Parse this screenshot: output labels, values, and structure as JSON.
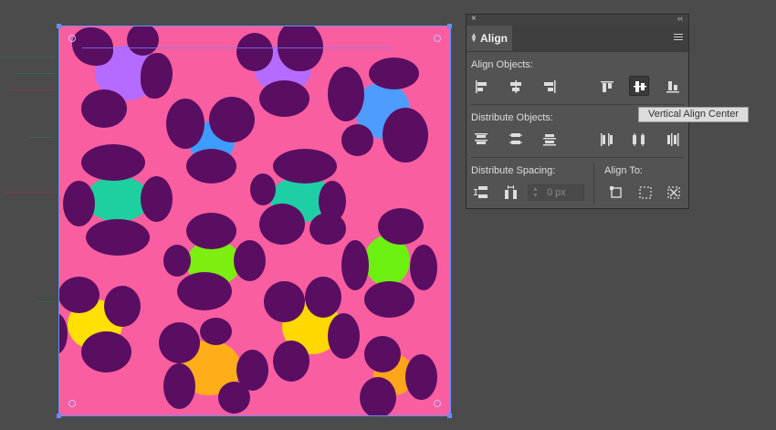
{
  "panel": {
    "title": "Align",
    "close_glyph": "×",
    "collapse_glyph": "‹‹",
    "tab_arrows_icon": "up-down-arrows-icon",
    "menu_icon": "hamburger-menu-icon",
    "sections": {
      "align_objects": "Align Objects:",
      "distribute_objects": "Distribute Objects:",
      "distribute_spacing": "Distribute Spacing:",
      "align_to": "Align To:"
    },
    "spacing_value": "0 px",
    "align_buttons": [
      "horizontal-align-left",
      "horizontal-align-center",
      "horizontal-align-right",
      "vertical-align-top",
      "vertical-align-center",
      "vertical-align-bottom"
    ],
    "active_button": "vertical-align-center",
    "tooltip": "Vertical Align Center"
  },
  "colors": {
    "background": "#4b4b4b",
    "artboard_fill": "#f95fa0",
    "spot_dark": "#5a0e62",
    "selection": "#6b8cff",
    "panel_bg": "#535353"
  }
}
